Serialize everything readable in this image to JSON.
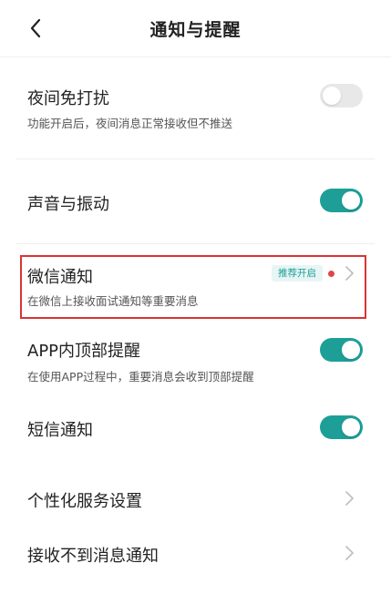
{
  "header": {
    "title": "通知与提醒",
    "back_icon": "chevron-left-icon"
  },
  "settings": [
    {
      "key": "dnd",
      "label": "夜间免打扰",
      "desc": "功能开启后，夜间消息正常接收但不推送",
      "toggle": "off"
    },
    {
      "key": "sound",
      "label": "声音与振动",
      "toggle": "on"
    },
    {
      "key": "wechat",
      "label": "微信通知",
      "desc": "在微信上接收面试通知等重要消息",
      "badge": "推荐开启",
      "has_dot": true
    },
    {
      "key": "app_top",
      "label": "APP内顶部提醒",
      "desc": "在使用APP过程中，重要消息会收到顶部提醒",
      "toggle": "on"
    },
    {
      "key": "sms",
      "label": "短信通知",
      "toggle": "on"
    },
    {
      "key": "personalized",
      "label": "个性化服务设置"
    },
    {
      "key": "not_received",
      "label": "接收不到消息通知"
    }
  ],
  "colors": {
    "accent": "#1d9f98",
    "toggle_off": "#e8e8e8",
    "highlight_border": "#d93434",
    "dot": "#e04646"
  }
}
